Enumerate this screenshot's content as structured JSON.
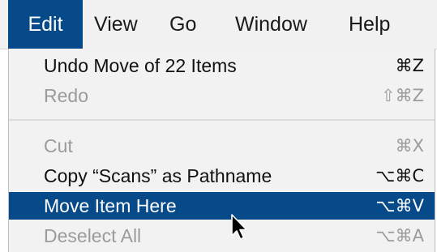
{
  "menubar": {
    "items": [
      {
        "label": "Edit",
        "active": true
      },
      {
        "label": "View",
        "active": false
      },
      {
        "label": "Go",
        "active": false
      },
      {
        "label": "Window",
        "active": false
      },
      {
        "label": "Help",
        "active": false
      }
    ]
  },
  "edit_menu": {
    "items": [
      {
        "label": "Undo Move of 22 Items",
        "shortcut": "⌘Z",
        "state": "enabled"
      },
      {
        "label": "Redo",
        "shortcut": "⇧⌘Z",
        "state": "disabled"
      },
      {
        "label": "Cut",
        "shortcut": "⌘X",
        "state": "disabled"
      },
      {
        "label": "Copy “Scans” as Pathname",
        "shortcut": "⌥⌘C",
        "state": "enabled"
      },
      {
        "label": "Move Item Here",
        "shortcut": "⌥⌘V",
        "state": "highlighted"
      },
      {
        "label": "Deselect All",
        "shortcut": "⌥⌘A",
        "state": "disabled"
      }
    ]
  },
  "colors": {
    "highlight": "#064a8a",
    "menu_background": "#f2f2f2",
    "disabled_text": "#9b9b9b"
  },
  "icons": {
    "pointer": "arrow-pointer-icon"
  }
}
